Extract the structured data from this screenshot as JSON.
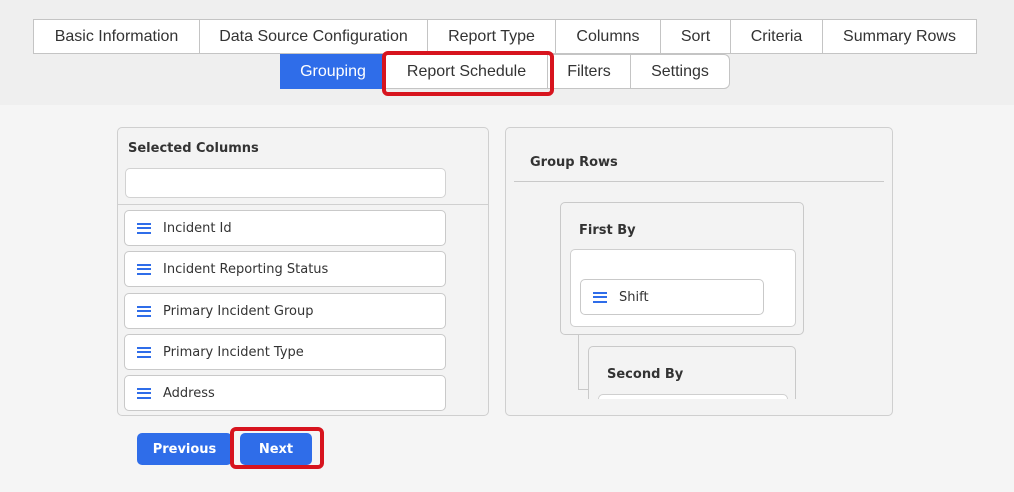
{
  "tabs_row1": [
    {
      "label": "Basic Information"
    },
    {
      "label": "Data Source Configuration"
    },
    {
      "label": "Report Type"
    },
    {
      "label": "Columns"
    },
    {
      "label": "Sort"
    },
    {
      "label": "Criteria"
    },
    {
      "label": "Summary Rows"
    }
  ],
  "tabs_row2": [
    {
      "label": "Grouping",
      "active": true
    },
    {
      "label": "Report Schedule",
      "highlighted": true
    },
    {
      "label": "Filters"
    },
    {
      "label": "Settings"
    }
  ],
  "selected_columns": {
    "title": "Selected Columns",
    "search_value": "",
    "items": [
      "Incident Id",
      "Incident Reporting Status",
      "Primary Incident Group",
      "Primary Incident Type",
      "Address"
    ]
  },
  "group_rows": {
    "title": "Group Rows",
    "first_by": {
      "label": "First By",
      "items": [
        "Shift"
      ]
    },
    "second_by": {
      "label": "Second By"
    }
  },
  "buttons": {
    "previous": "Previous",
    "next": "Next"
  },
  "colors": {
    "accent": "#2f6de9",
    "highlight": "#d7141e"
  },
  "icons": {
    "drag_handle": "drag-handle-icon"
  }
}
